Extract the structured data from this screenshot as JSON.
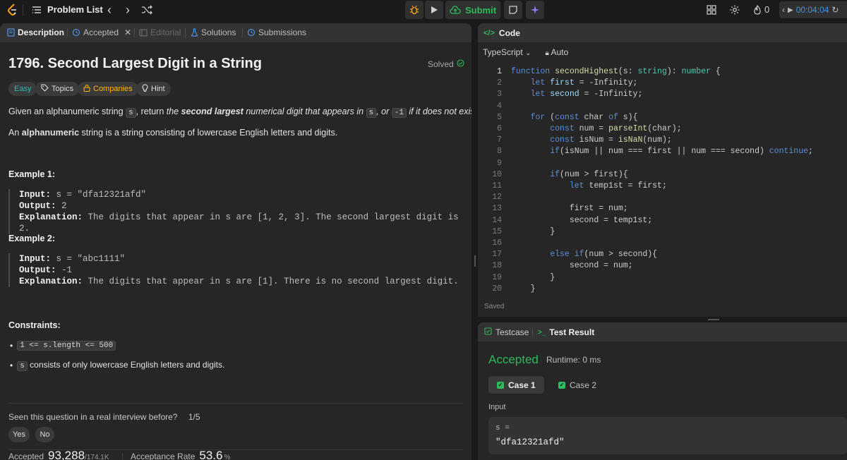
{
  "topbar": {
    "problem_list_label": "Problem List",
    "submit_label": "Submit",
    "streak_count": "0",
    "timer": "00:04:04"
  },
  "tabs": [
    {
      "label": "Description"
    },
    {
      "label": "Accepted"
    },
    {
      "label": "Editorial"
    },
    {
      "label": "Solutions"
    },
    {
      "label": "Submissions"
    }
  ],
  "problem": {
    "title": "1796. Second Largest Digit in a String",
    "status": "Solved",
    "chips": {
      "difficulty": "Easy",
      "topics": "Topics",
      "companies": "Companies",
      "hint": "Hint"
    },
    "desc1": {
      "a": "Given an alphanumeric string ",
      "code1": "s",
      "b": ", return ",
      "c": "the ",
      "d": "second largest",
      "e": " numerical digit that appears in ",
      "code2": "s",
      "f": ", or ",
      "code3": "-1",
      "g": " if it does not exist",
      "h": "."
    },
    "desc2": {
      "a": "An ",
      "b": "alphanumeric",
      "c": " string is a string consisting of lowercase English letters and digits."
    },
    "examples": [
      {
        "heading": "Example 1:",
        "input_label": "Input:",
        "input": " s = \"dfa12321afd\"",
        "output_label": "Output:",
        "output": " 2",
        "expl_label": "Explanation:",
        "expl": " The digits that appear in s are [1, 2, 3]. The second largest digit is 2."
      },
      {
        "heading": "Example 2:",
        "input_label": "Input:",
        "input": " s = \"abc1111\"",
        "output_label": "Output:",
        "output": " -1",
        "expl_label": "Explanation:",
        "expl": " The digits that appear in s are [1]. There is no second largest digit."
      }
    ],
    "constraints_heading": "Constraints:",
    "constraint1_code": "1 <= s.length <= 500",
    "constraint2_code": "s",
    "constraint2_text": " consists of only lowercase English letters and digits.",
    "seen_question": "Seen this question in a real interview before?",
    "seen_count": "1/5",
    "yes": "Yes",
    "no": "No",
    "stats": {
      "accepted_label": "Accepted",
      "accepted_value": "93,288",
      "accepted_total": "/174.1K",
      "rate_label": "Acceptance Rate",
      "rate_value": "53.6",
      "rate_unit": "%"
    }
  },
  "code": {
    "header": "Code",
    "language": "TypeScript",
    "auto": "Auto",
    "saved": "Saved",
    "lines": [
      "1",
      "2",
      "3",
      "4",
      "5",
      "6",
      "7",
      "8",
      "9",
      "10",
      "11",
      "12",
      "13",
      "14",
      "15",
      "16",
      "17",
      "18",
      "19",
      "20"
    ],
    "text": {
      "l1_kw": "function ",
      "l1_fn": "secondHighest",
      "l1_a": "(s: ",
      "l1_ty": "string",
      "l1_b": "): ",
      "l1_ty2": "number",
      "l1_c": " {",
      "l2_kw": "let ",
      "l2_vr": "first",
      "l2_a": " = -Infinity;",
      "l3_kw": "let ",
      "l3_vr": "second",
      "l3_a": " = -Infinity;",
      "l5_kw": "for ",
      "l5_a": "(",
      "l5_kw2": "const ",
      "l5_b": "char ",
      "l5_kw3": "of ",
      "l5_c": "s){",
      "l6_kw": "const ",
      "l6_a": "num = ",
      "l6_fn": "parseInt",
      "l6_b": "(char);",
      "l7_kw": "const ",
      "l7_a": "isNum = ",
      "l7_fn": "isNaN",
      "l7_b": "(num);",
      "l8_kw": "if",
      "l8_a": "(isNum || num === first || num === second) ",
      "l8_kw2": "continue",
      "l8_b": ";",
      "l10_kw": "if",
      "l10_a": "(num > first){",
      "l11_kw": "let ",
      "l11_a": "temp1st = first;",
      "l13_a": "first = num;",
      "l14_a": "second = temp1st;",
      "l15_a": "}",
      "l17_kw": "else if",
      "l17_a": "(num > second){",
      "l18_a": "second = num;",
      "l19_a": "}",
      "l20_a": "}"
    }
  },
  "result": {
    "tab_testcase": "Testcase",
    "tab_result": "Test Result",
    "status": "Accepted",
    "runtime": "Runtime: 0 ms",
    "case1": "Case 1",
    "case2": "Case 2",
    "input_label": "Input",
    "input_var": "s =",
    "input_value": "\"dfa12321afd\""
  },
  "colors": {
    "accent_green": "#2cbb5d",
    "easy": "#2cbbb3",
    "companies": "#ffb800",
    "timer": "#4a90e2"
  }
}
